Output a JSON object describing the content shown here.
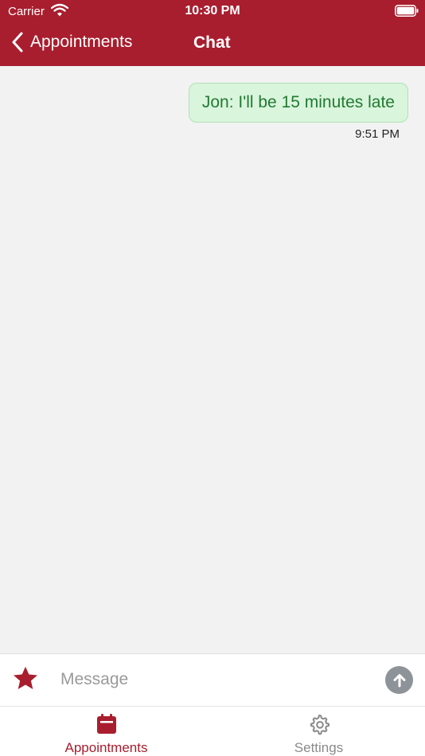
{
  "status": {
    "carrier": "Carrier",
    "time": "10:30 PM"
  },
  "nav": {
    "back_label": "Appointments",
    "title": "Chat"
  },
  "messages": [
    {
      "text": "Jon: I'll be 15 minutes late",
      "time": "9:51 PM"
    }
  ],
  "composer": {
    "placeholder": "Message"
  },
  "tabs": [
    {
      "label": "Appointments",
      "icon": "calendar-icon",
      "active": true
    },
    {
      "label": "Settings",
      "icon": "gear-icon",
      "active": false
    }
  ],
  "colors": {
    "brand": "#a81e2e",
    "bubble_bg": "#d9f5dc",
    "bubble_text": "#227a32",
    "send": "#8e9399"
  }
}
